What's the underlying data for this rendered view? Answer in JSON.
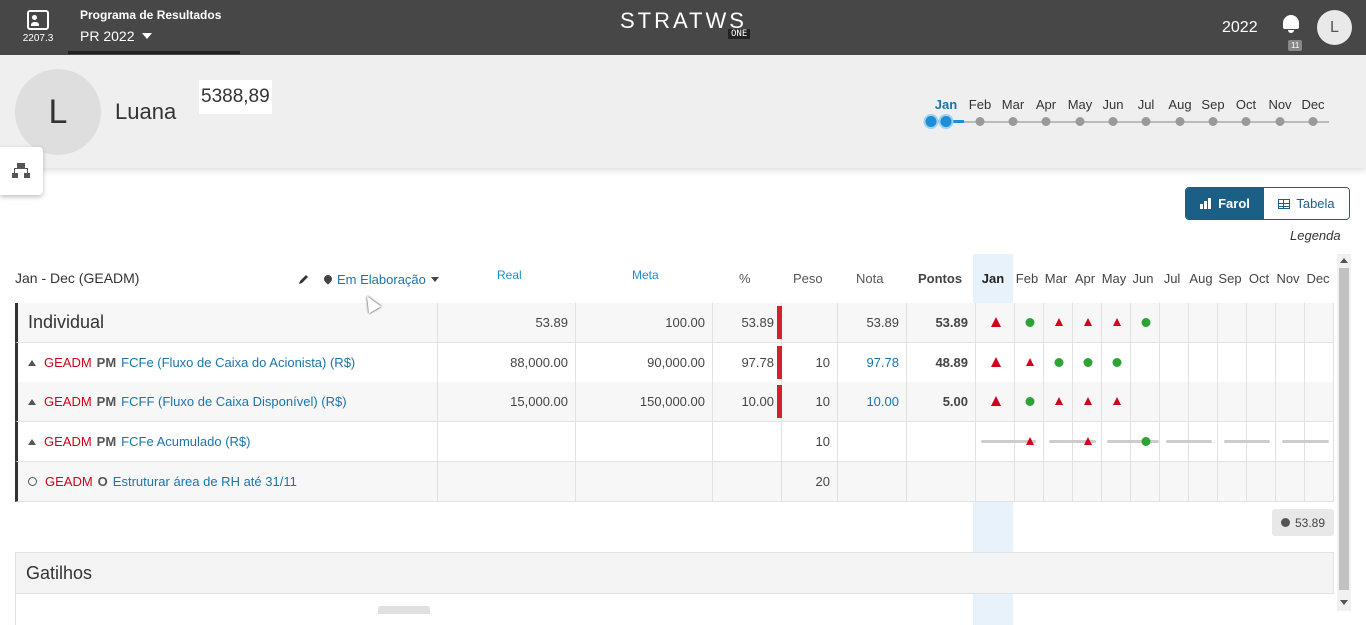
{
  "topbar": {
    "version": "2207.3",
    "program_title": "Programa de Resultados",
    "program_selected": "PR 2022",
    "logo_text": "STRATWS",
    "logo_badge": "ONE",
    "year": "2022",
    "notifications": "11",
    "user_initial": "L"
  },
  "profile": {
    "initial": "L",
    "name": "Luana",
    "score": "5388,89"
  },
  "timeline": {
    "months": [
      "Jan",
      "Feb",
      "Mar",
      "Apr",
      "May",
      "Jun",
      "Jul",
      "Aug",
      "Sep",
      "Oct",
      "Nov",
      "Dec"
    ],
    "active": "Jan"
  },
  "view_toggle": {
    "farol": "Farol",
    "tabela": "Tabela"
  },
  "legend_link": "Legenda",
  "table": {
    "period": "Jan - Dec (GEADM)",
    "status": "Em Elaboração",
    "headers": {
      "real": "Real",
      "meta": "Meta",
      "pct": "%",
      "peso": "Peso",
      "nota": "Nota",
      "pontos": "Pontos"
    },
    "months": [
      "Jan",
      "Feb",
      "Mar",
      "Apr",
      "May",
      "Jun",
      "Jul",
      "Aug",
      "Sep",
      "Oct",
      "Nov",
      "Dec"
    ],
    "rows": [
      {
        "label": "Individual",
        "real": "53.89",
        "meta": "100.00",
        "pct": "53.89",
        "peso": "",
        "nota": "53.89",
        "pontos": "53.89"
      },
      {
        "unit": "GEADM",
        "type": "PM",
        "label": "FCFe (Fluxo de Caixa do Acionista) (R$)",
        "real": "88,000.00",
        "meta": "90,000.00",
        "pct": "97.78",
        "peso": "10",
        "nota": "97.78",
        "pontos": "48.89"
      },
      {
        "unit": "GEADM",
        "type": "PM",
        "label": "FCFF (Fluxo de Caixa Disponível) (R$)",
        "real": "15,000.00",
        "meta": "150,000.00",
        "pct": "10.00",
        "peso": "10",
        "nota": "10.00",
        "pontos": "5.00"
      },
      {
        "unit": "GEADM",
        "type": "PM",
        "label": "FCFe Acumulado (R$)",
        "real": "",
        "meta": "",
        "pct": "",
        "peso": "10",
        "nota": "",
        "pontos": ""
      },
      {
        "unit": "GEADM",
        "type": "O",
        "label": "Estruturar área de RH até 31/11",
        "real": "",
        "meta": "",
        "pct": "",
        "peso": "20",
        "nota": "",
        "pontos": ""
      }
    ],
    "total": "53.89"
  },
  "gatilhos_title": "Gatilhos",
  "colors": {
    "topbar": "#474747",
    "accent": "#1b5f87",
    "alert": "#d0021b",
    "ok": "#2ea335"
  }
}
